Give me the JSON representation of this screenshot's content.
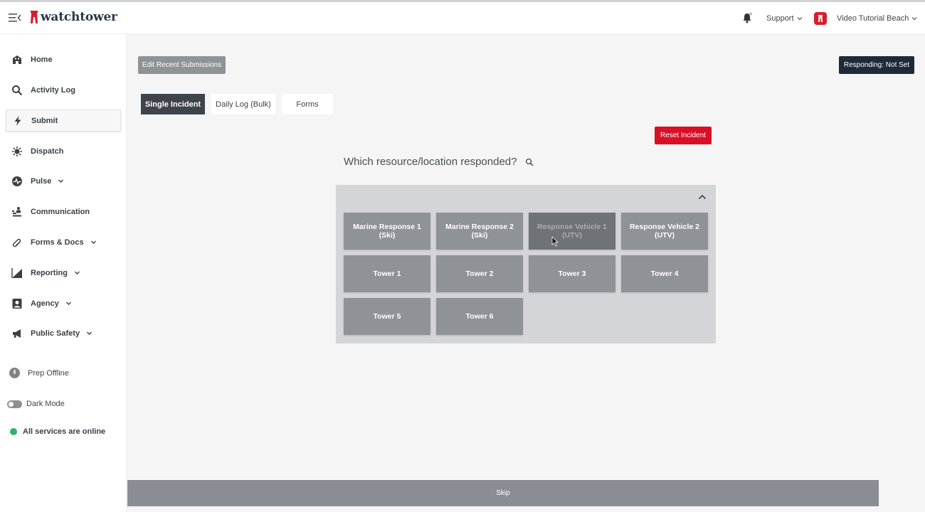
{
  "header": {
    "brand": "watchtower",
    "support_label": "Support",
    "agency_name": "Video Tutorial Beach"
  },
  "sidebar": {
    "items": [
      {
        "label": "Home",
        "icon": "home-icon"
      },
      {
        "label": "Activity Log",
        "icon": "search-icon"
      },
      {
        "label": "Submit",
        "icon": "bolt-icon",
        "active": true
      },
      {
        "label": "Dispatch",
        "icon": "siren-icon"
      },
      {
        "label": "Pulse",
        "icon": "pulse-icon",
        "dropdown": true
      },
      {
        "label": "Communication",
        "icon": "communication-icon"
      },
      {
        "label": "Forms & Docs",
        "icon": "paperclip-icon",
        "dropdown": true
      },
      {
        "label": "Reporting",
        "icon": "chart-icon",
        "dropdown": true
      },
      {
        "label": "Agency",
        "icon": "user-badge-icon",
        "dropdown": true
      },
      {
        "label": "Public Safety",
        "icon": "megaphone-icon",
        "dropdown": true
      }
    ],
    "prep_offline": "Prep Offline",
    "dark_mode": "Dark Mode",
    "status": "All services are online"
  },
  "main": {
    "edit_recent": "Edit Recent Submissions",
    "responding": "Responding: Not Set",
    "tabs": [
      {
        "label": "Single Incident",
        "active": true
      },
      {
        "label": "Daily Log (Bulk)"
      },
      {
        "label": "Forms"
      }
    ],
    "reset_incident": "Reset Incident",
    "question": "Which resource/location responded?",
    "resources": [
      "Marine Response 1\n(Ski)",
      "Marine Response 2\n(Ski)",
      "Response Vehicle 1\n(UTV)",
      "Response Vehicle 2\n(UTV)",
      "Tower 1",
      "Tower 2",
      "Tower 3",
      "Tower 4",
      "Tower 5",
      "Tower 6"
    ],
    "skip": "Skip"
  },
  "colors": {
    "brand_red": "#d81e2c",
    "reset_red": "#d90f26",
    "navy": "#1e2a38",
    "tile_gray": "#8f9297",
    "status_green": "#2fb36a"
  }
}
